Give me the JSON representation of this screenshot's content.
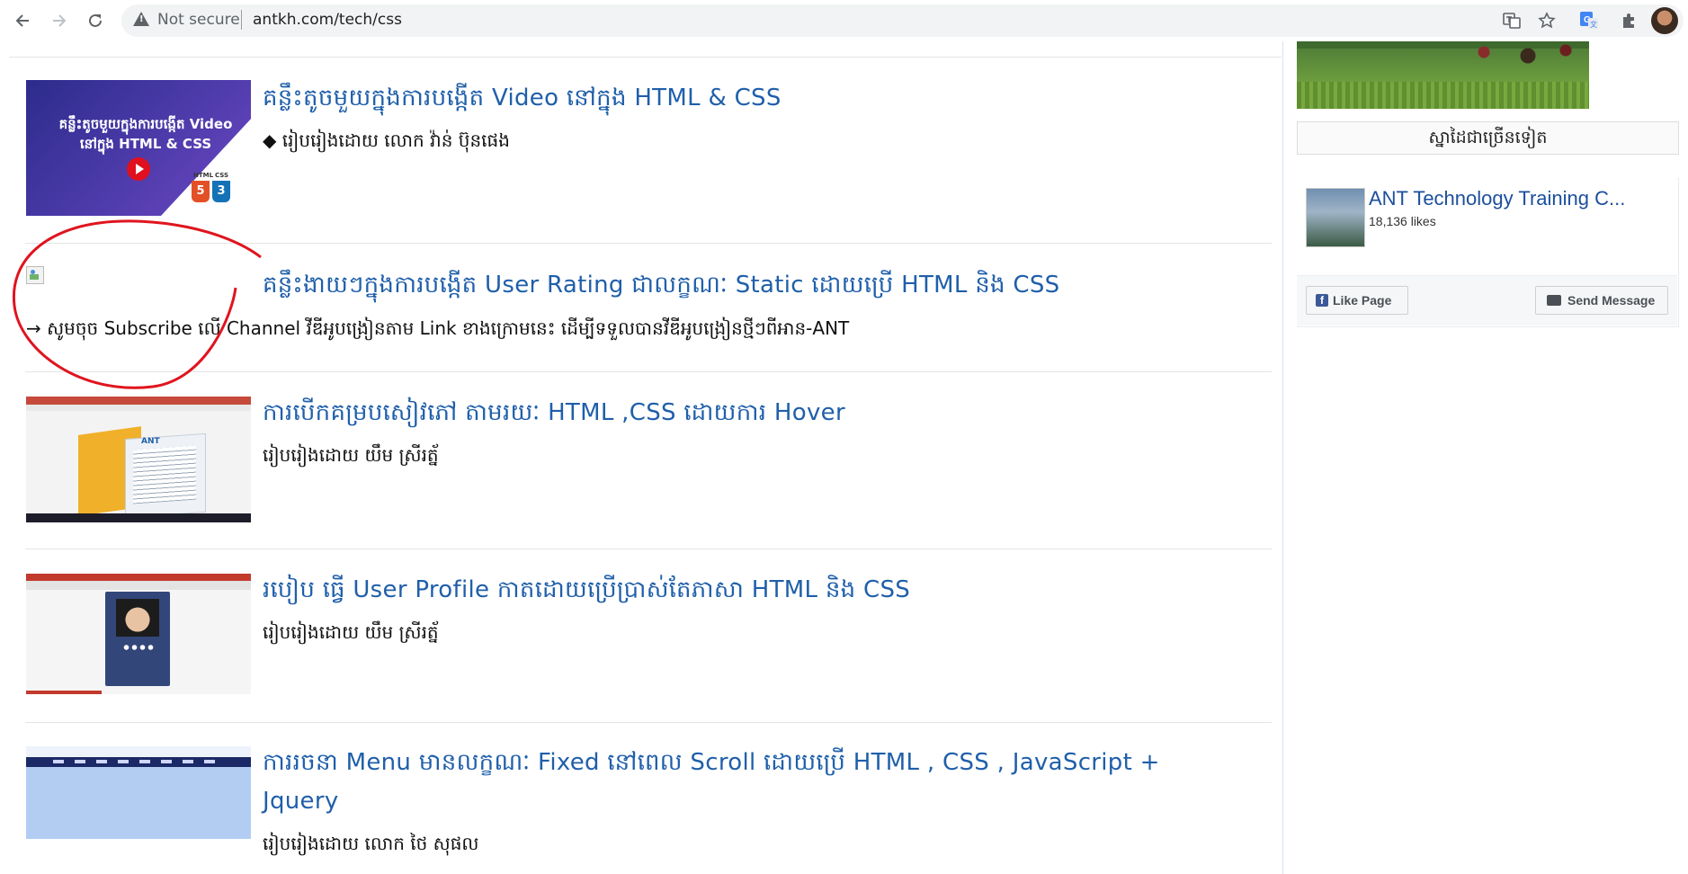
{
  "browser": {
    "security_text": "Not secure",
    "url": "antkh.com/tech/css",
    "icons": [
      "back-icon",
      "forward-icon",
      "reload-icon",
      "warning-icon",
      "translate-icon",
      "star-icon",
      "google-translate-icon",
      "extensions-icon",
      "profile-avatar"
    ]
  },
  "posts": [
    {
      "title": "គន្លឹះតូចមួយក្នុងការបង្កើត Video នៅក្នុង HTML & CSS",
      "meta": "◆ រៀបរៀងដោយ លោក វ៉ាន់ ប៊ុនផេង",
      "thumb_text": "គន្លឹះតូចមួយក្នុងការបង្កើត Video នៅក្នុង HTML & CSS"
    },
    {
      "title": "គន្លឹះងាយៗក្នុងការបង្កើត User Rating ជាលក្ខណៈ Static ដោយប្រើ HTML និង CSS",
      "meta": "→ សូមចុច Subscribe លើ Channel វីឌីអូបង្រៀនតាម Link ខាងក្រោមនេះ ដើម្បីទទួលបានវីឌីអូបង្រៀនថ្មីៗពីអាន-ANT"
    },
    {
      "title": "ការបើកគម្របសៀវភៅ តាមរយៈ HTML ,CSS ដោយការ Hover",
      "meta": "រៀបរៀងដោយ  យឹម ស្រីរត្ន័",
      "thumb_text": "ANT"
    },
    {
      "title": "របៀប ធ្វើ User Profile កាតដោយប្រើប្រាស់តែភាសា HTML និង CSS",
      "meta": "រៀបរៀងដោយ  យឹម ស្រីរត្ន័"
    },
    {
      "title_line1": "ការរចនា Menu មានលក្ខណៈ Fixed នៅពេល Scroll ដោយប្រើ HTML , CSS , JavaScript +",
      "title_line2": "Jquery",
      "meta": "រៀបរៀងដោយ លោក ថៃ សុផល"
    }
  ],
  "badges": {
    "html": "HTML",
    "css": "CSS",
    "html_num": "5",
    "css_num": "3"
  },
  "sidebar": {
    "more_label": "ស្នាដៃជាច្រើនទៀត",
    "fb_page_name": "ANT Technology Training C...",
    "fb_likes": "18,136 likes",
    "like_page_label": "Like Page",
    "send_message_label": "Send Message"
  },
  "colors": {
    "link": "#1f5faa",
    "annotation": "#e0141e"
  }
}
